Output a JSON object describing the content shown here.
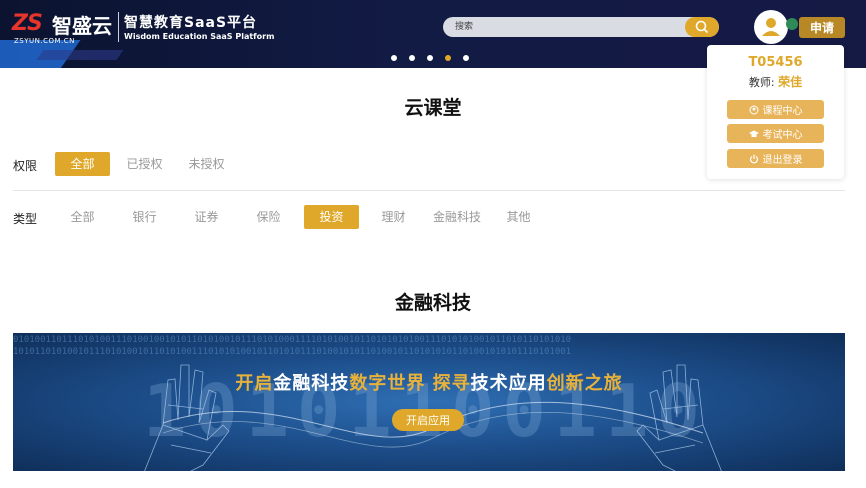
{
  "header": {
    "logo_mark": "ZS",
    "logo_name": "智盛云",
    "logo_url": "ZSYUN.COM.CN",
    "logo_subtitle": "智慧教育SaaS平台",
    "logo_subtitle_en": "Wisdom Education SaaS Platform",
    "search_placeholder": "搜索",
    "search_icon": "search-icon",
    "carousel_dots": 5,
    "carousel_active_index": 3,
    "apply_label": "申请",
    "avatar_icon": "user-icon"
  },
  "user_menu": {
    "user_id": "T05456",
    "role_label": "教师:",
    "user_name": "荣佳",
    "items": [
      {
        "label": "课程中心",
        "icon": "course-icon"
      },
      {
        "label": "考试中心",
        "icon": "exam-icon"
      },
      {
        "label": "退出登录",
        "icon": "power-icon"
      }
    ]
  },
  "section1": {
    "title": "云课堂",
    "permission_label": "权限",
    "permission_options": [
      "全部",
      "已授权",
      "未授权"
    ],
    "permission_selected": "全部",
    "type_label": "类型",
    "type_options": [
      "全部",
      "银行",
      "证券",
      "保险",
      "投资",
      "理财",
      "金融科技",
      "其他"
    ],
    "type_selected": "投资"
  },
  "section2": {
    "title": "金融科技",
    "banner_parts": [
      {
        "text": "开启",
        "color": "#e8b23a"
      },
      {
        "text": "金融科技",
        "color": "#ffffff"
      },
      {
        "text": "数字世界",
        "color": "#e8b23a"
      },
      {
        "text": " 探寻",
        "color": "#e8b23a"
      },
      {
        "text": "技术应用",
        "color": "#ffffff"
      },
      {
        "text": "创新之旅",
        "color": "#e8b23a"
      }
    ],
    "banner_button": "开启应用"
  },
  "colors": {
    "accent": "#e0a82a",
    "header_bg": "#121b44",
    "apply_bg": "#b98826",
    "brand_red": "#e8352c"
  }
}
